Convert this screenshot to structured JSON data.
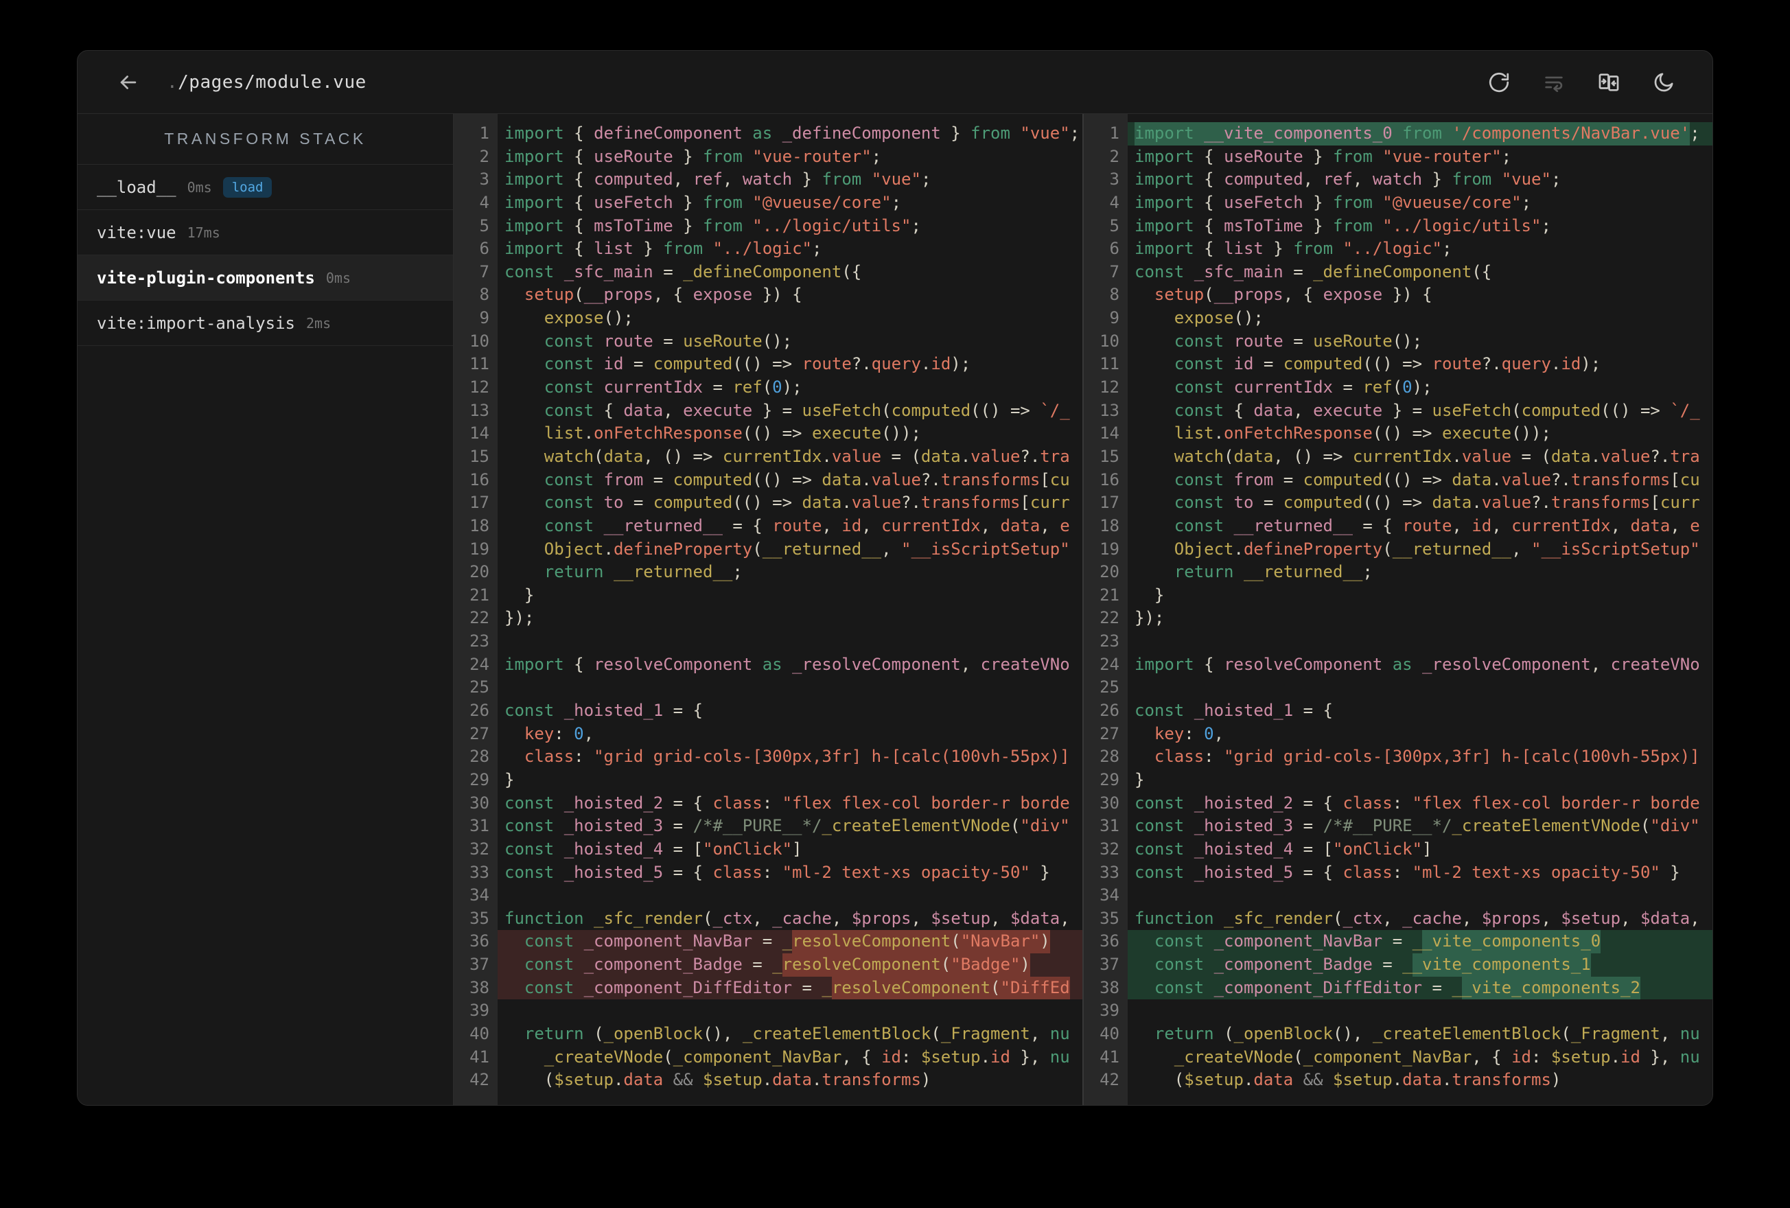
{
  "header": {
    "title_prefix": ".",
    "title_main": "/pages/module.vue",
    "back_label": "back",
    "actions": [
      {
        "name": "refresh",
        "disabled": false
      },
      {
        "name": "line-wrap",
        "disabled": true
      },
      {
        "name": "split-view",
        "disabled": false
      },
      {
        "name": "dark-mode",
        "disabled": false
      }
    ]
  },
  "sidebar": {
    "title": "TRANSFORM STACK",
    "items": [
      {
        "name": "__load__",
        "time": "0ms",
        "badge": "load",
        "selected": false
      },
      {
        "name": "vite:vue",
        "time": "17ms",
        "selected": false
      },
      {
        "name": "vite-plugin-components",
        "time": "0ms",
        "selected": true
      },
      {
        "name": "vite:import-analysis",
        "time": "2ms",
        "selected": false
      }
    ]
  },
  "colors": {
    "keyword": "#4d9b76",
    "identifier": "#ce8ca5",
    "function": "#c0aa54",
    "string": "#e07a63",
    "punctuation": "#d8d4c6",
    "number": "#4fa0dc",
    "comment": "#7f8e7a",
    "removed_line_bg": "#3b2423",
    "removed_word_bg": "#76382f",
    "added_line_bg": "#1e3b2c",
    "added_word_bg": "#2f604a",
    "badge_bg": "#16384f",
    "badge_text": "#53a9e4"
  },
  "code": {
    "line_count": 42,
    "del_lines": [
      36,
      37,
      38
    ],
    "add_lines": [
      1,
      36,
      37,
      38
    ],
    "lines": {
      "1": [
        [
          "k",
          "import "
        ],
        [
          "p",
          "{ "
        ],
        [
          "i",
          "defineComponent"
        ],
        [
          "k",
          " as "
        ],
        [
          "i",
          "_defineComponent"
        ],
        [
          "p",
          " } "
        ],
        [
          "k",
          "from "
        ],
        [
          "s",
          "\"vue\""
        ],
        [
          "p",
          ";"
        ]
      ],
      "2": [
        [
          "k",
          "import "
        ],
        [
          "p",
          "{ "
        ],
        [
          "i",
          "useRoute"
        ],
        [
          "p",
          " } "
        ],
        [
          "k",
          "from "
        ],
        [
          "s",
          "\"vue-router\""
        ],
        [
          "p",
          ";"
        ]
      ],
      "3": [
        [
          "k",
          "import "
        ],
        [
          "p",
          "{ "
        ],
        [
          "i",
          "computed"
        ],
        [
          "p",
          ", "
        ],
        [
          "i",
          "ref"
        ],
        [
          "p",
          ", "
        ],
        [
          "i",
          "watch"
        ],
        [
          "p",
          " } "
        ],
        [
          "k",
          "from "
        ],
        [
          "s",
          "\"vue\""
        ],
        [
          "p",
          ";"
        ]
      ],
      "4": [
        [
          "k",
          "import "
        ],
        [
          "p",
          "{ "
        ],
        [
          "i",
          "useFetch"
        ],
        [
          "p",
          " } "
        ],
        [
          "k",
          "from "
        ],
        [
          "s",
          "\"@vueuse/core\""
        ],
        [
          "p",
          ";"
        ]
      ],
      "5": [
        [
          "k",
          "import "
        ],
        [
          "p",
          "{ "
        ],
        [
          "i",
          "msToTime"
        ],
        [
          "p",
          " } "
        ],
        [
          "k",
          "from "
        ],
        [
          "s",
          "\"../logic/utils\""
        ],
        [
          "p",
          ";"
        ]
      ],
      "6": [
        [
          "k",
          "import "
        ],
        [
          "p",
          "{ "
        ],
        [
          "i",
          "list"
        ],
        [
          "p",
          " } "
        ],
        [
          "k",
          "from "
        ],
        [
          "s",
          "\"../logic\""
        ],
        [
          "p",
          ";"
        ]
      ],
      "7": [
        [
          "k",
          "const "
        ],
        [
          "i",
          "_sfc_main"
        ],
        [
          "p",
          " = "
        ],
        [
          "f",
          "_defineComponent"
        ],
        [
          "p",
          "({"
        ]
      ],
      "8": [
        [
          "p",
          "  "
        ],
        [
          "s",
          "setup"
        ],
        [
          "p",
          "("
        ],
        [
          "i",
          "__props"
        ],
        [
          "p",
          ", { "
        ],
        [
          "i",
          "expose"
        ],
        [
          "p",
          " }) {"
        ]
      ],
      "9": [
        [
          "p",
          "    "
        ],
        [
          "f",
          "expose"
        ],
        [
          "p",
          "();"
        ]
      ],
      "10": [
        [
          "p",
          "    "
        ],
        [
          "k",
          "const "
        ],
        [
          "i",
          "route"
        ],
        [
          "p",
          " = "
        ],
        [
          "f",
          "useRoute"
        ],
        [
          "p",
          "();"
        ]
      ],
      "11": [
        [
          "p",
          "    "
        ],
        [
          "k",
          "const "
        ],
        [
          "i",
          "id"
        ],
        [
          "p",
          " = "
        ],
        [
          "f",
          "computed"
        ],
        [
          "p",
          "(() => "
        ],
        [
          "s",
          "route"
        ],
        [
          "p",
          "?."
        ],
        [
          "s",
          "query"
        ],
        [
          "p",
          "."
        ],
        [
          "s",
          "id"
        ],
        [
          "p",
          ");"
        ]
      ],
      "12": [
        [
          "p",
          "    "
        ],
        [
          "k",
          "const "
        ],
        [
          "i",
          "currentIdx"
        ],
        [
          "p",
          " = "
        ],
        [
          "f",
          "ref"
        ],
        [
          "p",
          "("
        ],
        [
          "n",
          "0"
        ],
        [
          "p",
          ");"
        ]
      ],
      "13": [
        [
          "p",
          "    "
        ],
        [
          "k",
          "const "
        ],
        [
          "p",
          "{ "
        ],
        [
          "i",
          "data"
        ],
        [
          "p",
          ", "
        ],
        [
          "i",
          "execute"
        ],
        [
          "p",
          " } = "
        ],
        [
          "f",
          "useFetch"
        ],
        [
          "p",
          "("
        ],
        [
          "f",
          "computed"
        ],
        [
          "p",
          "(() => "
        ],
        [
          "s",
          "`/_"
        ]
      ],
      "14": [
        [
          "p",
          "    "
        ],
        [
          "f",
          "list"
        ],
        [
          "p",
          "."
        ],
        [
          "s",
          "onFetchResponse"
        ],
        [
          "p",
          "(() => "
        ],
        [
          "f",
          "execute"
        ],
        [
          "p",
          "());"
        ]
      ],
      "15": [
        [
          "p",
          "    "
        ],
        [
          "f",
          "watch"
        ],
        [
          "p",
          "("
        ],
        [
          "f",
          "data"
        ],
        [
          "p",
          ", () => "
        ],
        [
          "f",
          "currentIdx"
        ],
        [
          "p",
          "."
        ],
        [
          "s",
          "value"
        ],
        [
          "p",
          " = ("
        ],
        [
          "f",
          "data"
        ],
        [
          "p",
          "."
        ],
        [
          "s",
          "value"
        ],
        [
          "p",
          "?."
        ],
        [
          "s",
          "tra"
        ]
      ],
      "16": [
        [
          "p",
          "    "
        ],
        [
          "k",
          "const "
        ],
        [
          "i",
          "from"
        ],
        [
          "p",
          " = "
        ],
        [
          "f",
          "computed"
        ],
        [
          "p",
          "(() => "
        ],
        [
          "f",
          "data"
        ],
        [
          "p",
          "."
        ],
        [
          "s",
          "value"
        ],
        [
          "p",
          "?."
        ],
        [
          "s",
          "transforms"
        ],
        [
          "p",
          "["
        ],
        [
          "f",
          "cu"
        ]
      ],
      "17": [
        [
          "p",
          "    "
        ],
        [
          "k",
          "const "
        ],
        [
          "i",
          "to"
        ],
        [
          "p",
          " = "
        ],
        [
          "f",
          "computed"
        ],
        [
          "p",
          "(() => "
        ],
        [
          "f",
          "data"
        ],
        [
          "p",
          "."
        ],
        [
          "s",
          "value"
        ],
        [
          "p",
          "?."
        ],
        [
          "s",
          "transforms"
        ],
        [
          "p",
          "["
        ],
        [
          "f",
          "curr"
        ]
      ],
      "18": [
        [
          "p",
          "    "
        ],
        [
          "k",
          "const "
        ],
        [
          "i",
          "__returned__"
        ],
        [
          "p",
          " = { "
        ],
        [
          "s",
          "route"
        ],
        [
          "p",
          ", "
        ],
        [
          "s",
          "id"
        ],
        [
          "p",
          ", "
        ],
        [
          "s",
          "currentIdx"
        ],
        [
          "p",
          ", "
        ],
        [
          "s",
          "data"
        ],
        [
          "p",
          ", "
        ],
        [
          "s",
          "e"
        ]
      ],
      "19": [
        [
          "p",
          "    "
        ],
        [
          "f",
          "Object"
        ],
        [
          "p",
          "."
        ],
        [
          "s",
          "defineProperty"
        ],
        [
          "p",
          "("
        ],
        [
          "f",
          "__returned__"
        ],
        [
          "p",
          ", "
        ],
        [
          "s",
          "\"__isScriptSetup\""
        ]
      ],
      "20": [
        [
          "p",
          "    "
        ],
        [
          "k",
          "return "
        ],
        [
          "f",
          "__returned__"
        ],
        [
          "p",
          ";"
        ]
      ],
      "21": [
        [
          "p",
          "  }"
        ]
      ],
      "22": [
        [
          "p",
          "});"
        ]
      ],
      "23": [],
      "24": [
        [
          "k",
          "import "
        ],
        [
          "p",
          "{ "
        ],
        [
          "i",
          "resolveComponent"
        ],
        [
          "k",
          " as "
        ],
        [
          "i",
          "_resolveComponent"
        ],
        [
          "p",
          ", "
        ],
        [
          "i",
          "createVNo"
        ]
      ],
      "25": [],
      "26": [
        [
          "k",
          "const "
        ],
        [
          "i",
          "_hoisted_1"
        ],
        [
          "p",
          " = {"
        ]
      ],
      "27": [
        [
          "p",
          "  "
        ],
        [
          "s",
          "key"
        ],
        [
          "p",
          ": "
        ],
        [
          "n",
          "0"
        ],
        [
          "p",
          ","
        ]
      ],
      "28": [
        [
          "p",
          "  "
        ],
        [
          "s",
          "class"
        ],
        [
          "p",
          ": "
        ],
        [
          "s",
          "\"grid grid-cols-[300px,3fr] h-[calc(100vh-55px)]"
        ]
      ],
      "29": [
        [
          "p",
          "}"
        ]
      ],
      "30": [
        [
          "k",
          "const "
        ],
        [
          "i",
          "_hoisted_2"
        ],
        [
          "p",
          " = { "
        ],
        [
          "s",
          "class"
        ],
        [
          "p",
          ": "
        ],
        [
          "s",
          "\"flex flex-col border-r borde"
        ]
      ],
      "31": [
        [
          "k",
          "const "
        ],
        [
          "i",
          "_hoisted_3"
        ],
        [
          "p",
          " = "
        ],
        [
          "c",
          "/*#__PURE__*/"
        ],
        [
          "f",
          "_createElementVNode"
        ],
        [
          "p",
          "("
        ],
        [
          "s",
          "\"div\""
        ]
      ],
      "32": [
        [
          "k",
          "const "
        ],
        [
          "i",
          "_hoisted_4"
        ],
        [
          "p",
          " = ["
        ],
        [
          "s",
          "\"onClick\""
        ],
        [
          "p",
          "]"
        ]
      ],
      "33": [
        [
          "k",
          "const "
        ],
        [
          "i",
          "_hoisted_5"
        ],
        [
          "p",
          " = { "
        ],
        [
          "s",
          "class"
        ],
        [
          "p",
          ": "
        ],
        [
          "s",
          "\"ml-2 text-xs opacity-50\""
        ],
        [
          "p",
          " }"
        ]
      ],
      "34": [],
      "35": [
        [
          "k",
          "function "
        ],
        [
          "f",
          "_sfc_render"
        ],
        [
          "p",
          "("
        ],
        [
          "i",
          "_ctx"
        ],
        [
          "p",
          ", "
        ],
        [
          "i",
          "_cache"
        ],
        [
          "p",
          ", "
        ],
        [
          "i",
          "$props"
        ],
        [
          "p",
          ", "
        ],
        [
          "i",
          "$setup"
        ],
        [
          "p",
          ", "
        ],
        [
          "i",
          "$data"
        ],
        [
          "p",
          ","
        ]
      ],
      "36": [
        [
          "p",
          "  "
        ],
        [
          "k",
          "const "
        ],
        [
          "i",
          "_component_NavBar"
        ],
        [
          "p",
          " = "
        ],
        [
          "f",
          "_"
        ],
        [
          "f",
          "resolveComponent",
          1
        ],
        [
          "p",
          "(",
          1
        ],
        [
          "s",
          "\"NavBar\"",
          1
        ],
        [
          "p",
          ")",
          1
        ]
      ],
      "37": [
        [
          "p",
          "  "
        ],
        [
          "k",
          "const "
        ],
        [
          "i",
          "_component_Badge"
        ],
        [
          "p",
          " = "
        ],
        [
          "f",
          "_"
        ],
        [
          "f",
          "resolveComponent",
          1
        ],
        [
          "p",
          "(",
          1
        ],
        [
          "s",
          "\"Badge\"",
          1
        ],
        [
          "p",
          ")",
          1
        ]
      ],
      "38": [
        [
          "p",
          "  "
        ],
        [
          "k",
          "const "
        ],
        [
          "i",
          "_component_DiffEditor"
        ],
        [
          "p",
          " = "
        ],
        [
          "f",
          "_"
        ],
        [
          "f",
          "resolveComponent",
          1
        ],
        [
          "p",
          "(",
          1
        ],
        [
          "s",
          "\"DiffEd",
          1
        ]
      ],
      "39": [],
      "40": [
        [
          "p",
          "  "
        ],
        [
          "k",
          "return "
        ],
        [
          "p",
          "("
        ],
        [
          "f",
          "_openBlock"
        ],
        [
          "p",
          "(), "
        ],
        [
          "f",
          "_createElementBlock"
        ],
        [
          "p",
          "("
        ],
        [
          "f",
          "_Fragment"
        ],
        [
          "p",
          ", "
        ],
        [
          "k",
          "nu"
        ]
      ],
      "41": [
        [
          "p",
          "    "
        ],
        [
          "f",
          "_createVNode"
        ],
        [
          "p",
          "("
        ],
        [
          "f",
          "_component_NavBar"
        ],
        [
          "p",
          ", { "
        ],
        [
          "s",
          "id"
        ],
        [
          "p",
          ": "
        ],
        [
          "f",
          "$setup"
        ],
        [
          "p",
          "."
        ],
        [
          "s",
          "id"
        ],
        [
          "p",
          " }, "
        ],
        [
          "k",
          "nu"
        ]
      ],
      "42": [
        [
          "p",
          "    ("
        ],
        [
          "f",
          "$setup"
        ],
        [
          "p",
          "."
        ],
        [
          "s",
          "data"
        ],
        [
          "o",
          " && "
        ],
        [
          "f",
          "$setup"
        ],
        [
          "p",
          "."
        ],
        [
          "s",
          "data"
        ],
        [
          "p",
          "."
        ],
        [
          "s",
          "transforms"
        ],
        [
          "p",
          ")"
        ]
      ]
    },
    "right_overrides": {
      "1": [
        [
          "k",
          "import ",
          1
        ],
        [
          "i",
          "__vite_components_0",
          1
        ],
        [
          "k",
          " from ",
          1
        ],
        [
          "s",
          "'/components/NavBar.vue'",
          1
        ],
        [
          "p",
          ";"
        ]
      ],
      "36": [
        [
          "p",
          "  "
        ],
        [
          "k",
          "const "
        ],
        [
          "i",
          "_component_NavBar"
        ],
        [
          "p",
          " = "
        ],
        [
          "f",
          "_"
        ],
        [
          "f",
          "_vite_components_0",
          1
        ]
      ],
      "37": [
        [
          "p",
          "  "
        ],
        [
          "k",
          "const "
        ],
        [
          "i",
          "_component_Badge"
        ],
        [
          "p",
          " = "
        ],
        [
          "f",
          "_"
        ],
        [
          "f",
          "_vite_components_1",
          1
        ]
      ],
      "38": [
        [
          "p",
          "  "
        ],
        [
          "k",
          "const "
        ],
        [
          "i",
          "_component_DiffEditor"
        ],
        [
          "p",
          " = "
        ],
        [
          "f",
          "_"
        ],
        [
          "f",
          "_vite_components_2",
          1
        ]
      ]
    }
  }
}
